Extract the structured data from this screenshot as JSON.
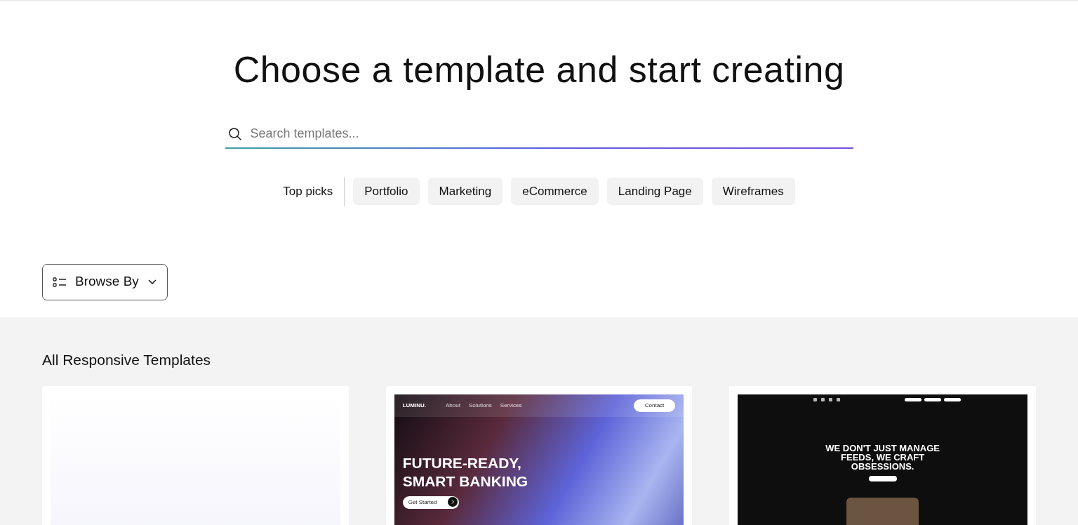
{
  "title": "Choose a template and start creating",
  "search": {
    "placeholder": "Search templates..."
  },
  "top_picks": {
    "label": "Top picks",
    "chips": [
      "Portfolio",
      "Marketing",
      "eCommerce",
      "Landing Page",
      "Wireframes"
    ]
  },
  "browse_button": {
    "label": "Browse By"
  },
  "section": {
    "title": "All Responsive Templates",
    "templates": [
      {
        "kind": "blank"
      },
      {
        "kind": "banking",
        "logo": "LUMINU.",
        "nav": [
          "About",
          "Solutions",
          "Services"
        ],
        "contact": "Contact",
        "headline": "FUTURE-READY,\nSMART BANKING",
        "cta": "Get Started"
      },
      {
        "kind": "social",
        "headline": "WE DON'T JUST MANAGE\nFEEDS, WE CRAFT\nOBSESSIONS."
      }
    ]
  }
}
